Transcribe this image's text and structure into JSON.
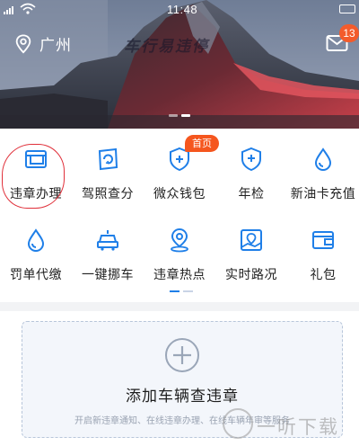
{
  "status_bar": {
    "time": "11:48"
  },
  "header": {
    "city": "广州",
    "slogan": "车行易违停",
    "message_badge": "13",
    "banner_active_index": 1,
    "banner_count": 2
  },
  "grid": {
    "items": [
      {
        "label": "违章办理",
        "icon": "violation-handle-icon"
      },
      {
        "label": "驾照查分",
        "icon": "license-score-icon"
      },
      {
        "label": "微众钱包",
        "icon": "shield-wallet-icon"
      },
      {
        "label": "年检",
        "icon": "shield-inspection-icon"
      },
      {
        "label": "新油卡充值",
        "icon": "oil-drop-icon"
      },
      {
        "label": "罚单代缴",
        "icon": "fine-drop-icon"
      },
      {
        "label": "一键挪车",
        "icon": "move-car-icon"
      },
      {
        "label": "违章热点",
        "icon": "hotspot-pin-icon"
      },
      {
        "label": "实时路况",
        "icon": "traffic-map-icon"
      },
      {
        "label": "礼包",
        "icon": "gift-wallet-icon"
      }
    ],
    "home_tag": "首页",
    "page_count": 2,
    "active_page": 1
  },
  "add_vehicle": {
    "title": "添加车辆查违章",
    "subtitle": "开启新违章通知、在线违章办理、在线车辆年审等服务"
  },
  "watermark": {
    "text": "一听下载"
  },
  "colors": {
    "accent_blue": "#1f7fe8",
    "badge_orange": "#f35b2b",
    "annotation_red": "#e0303a"
  }
}
